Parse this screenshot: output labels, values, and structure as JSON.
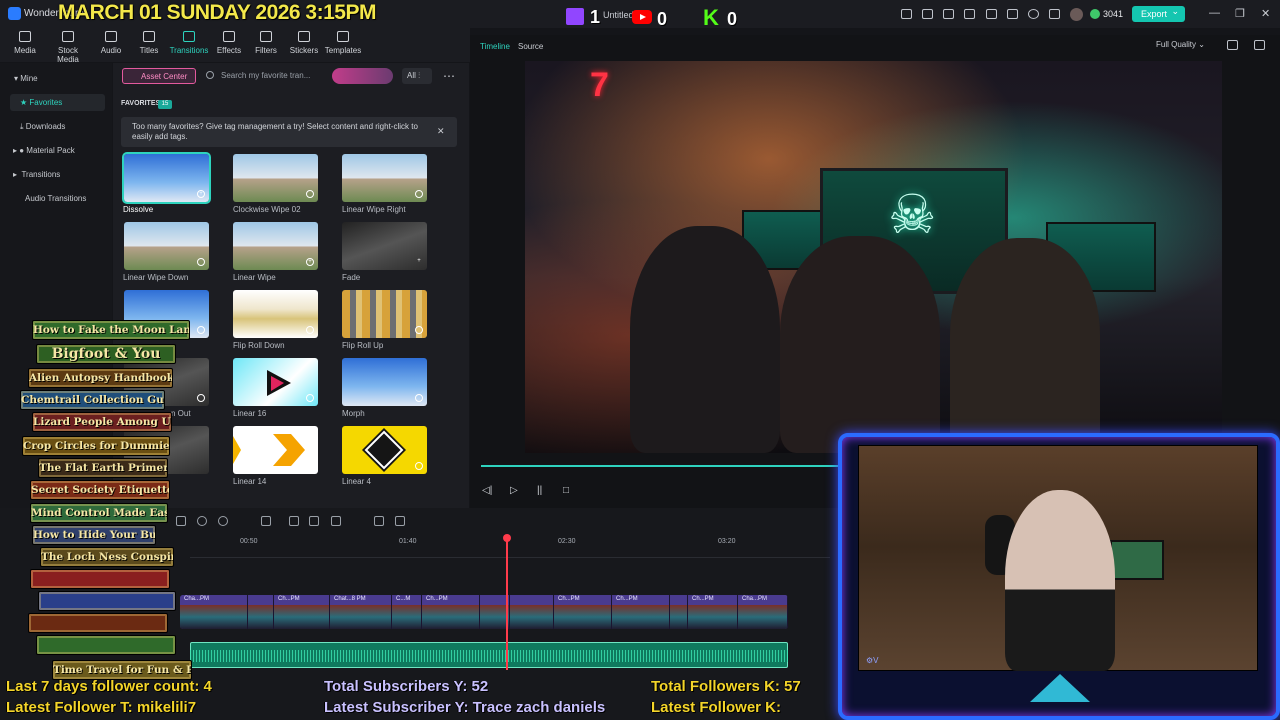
{
  "titlebar": {
    "app_name": "Wondershare",
    "overlay_date": "MARCH 01 SUNDAY 2026 3:15PM",
    "project_name": "Untitled",
    "twitch_count": "1",
    "youtube_count": "0",
    "kick_count": "0",
    "credits": "3041",
    "export_label": "Export",
    "brand_colors": {
      "accent": "#2ed3be",
      "twitch": "#9146ff",
      "youtube": "#ff0000",
      "kick": "#53fc18"
    }
  },
  "toolbar": {
    "items": [
      {
        "label": "Media",
        "icon": "media-icon"
      },
      {
        "label": "Stock Media",
        "icon": "stock-media-icon"
      },
      {
        "label": "Audio",
        "icon": "audio-icon"
      },
      {
        "label": "Titles",
        "icon": "titles-icon"
      },
      {
        "label": "Transitions",
        "icon": "transitions-icon",
        "active": true
      },
      {
        "label": "Effects",
        "icon": "effects-icon"
      },
      {
        "label": "Filters",
        "icon": "filters-icon"
      },
      {
        "label": "Stickers",
        "icon": "stickers-icon"
      },
      {
        "label": "Templates",
        "icon": "templates-icon"
      }
    ]
  },
  "sidebar": {
    "items": [
      {
        "label": "Mine"
      },
      {
        "label": "Favorites",
        "active": true
      },
      {
        "label": "Downloads"
      },
      {
        "label": "Material Pack"
      },
      {
        "label": "Transitions"
      },
      {
        "label": "Audio Transitions"
      }
    ]
  },
  "asset_panel": {
    "asset_center_label": "Asset Center",
    "search_placeholder": "Search my favorite tran...",
    "filter_label": "All",
    "favorites_heading": "FAVORITES",
    "favorites_count": "15",
    "tip_text": "Too many favorites? Give tag management a try! Select content and right-click to easily add tags.",
    "thumbnails": [
      {
        "label": "Dissolve",
        "selected": true
      },
      {
        "label": "Clockwise Wipe 02"
      },
      {
        "label": "Linear Wipe Right"
      },
      {
        "label": "Linear Wipe Down"
      },
      {
        "label": "Linear Wipe"
      },
      {
        "label": "Fade"
      },
      {
        "label": ""
      },
      {
        "label": "Flip Roll Down"
      },
      {
        "label": "Flip Roll Up"
      },
      {
        "label": "n Out"
      },
      {
        "label": "Linear 16"
      },
      {
        "label": "Morph"
      },
      {
        "label": ""
      },
      {
        "label": "Linear 14"
      },
      {
        "label": "Linear 4"
      }
    ]
  },
  "player": {
    "tab_timeline": "Timeline",
    "tab_source": "Source",
    "quality": "Full Quality",
    "neon_sign": "7"
  },
  "timeline": {
    "ticks": [
      "00:50",
      "01:40",
      "02:30",
      "03:20"
    ],
    "clips": [
      "Cha...PM",
      "Ch...PM",
      "Chat...8 PM",
      "C...M",
      "Ch...PM",
      "Ch...PM",
      "Ch...PM",
      "Ch...PM",
      "Ch...PM",
      "Cha...PM"
    ]
  },
  "books": [
    "How to Fake the Moon Landing",
    "Bigfoot & You",
    "Alien Autopsy Handbook",
    "Chemtrail Collection Guide",
    "Lizard People Among Us",
    "Crop Circles for Dummies",
    "The Flat Earth Primer",
    "Secret Society Etiquette",
    "Mind Control Made Easy",
    "How to Hide Your Bunker",
    "The Loch Ness Conspiracy",
    "",
    "",
    "",
    "",
    "Time Travel for Fun & Profit"
  ],
  "stats": {
    "followers_7day": "Last 7 days follower count: 4",
    "latest_follower_t": "Latest Follower T: mikelili7",
    "total_subscribers_y": "Total Subscribers Y: 52",
    "latest_subscriber_y": "Latest Subscriber Y: Trace zach daniels",
    "total_followers_k": "Total Followers K: 57",
    "latest_follower_k": "Latest Follower K:"
  },
  "webcam": {
    "logo": "⚙V"
  }
}
